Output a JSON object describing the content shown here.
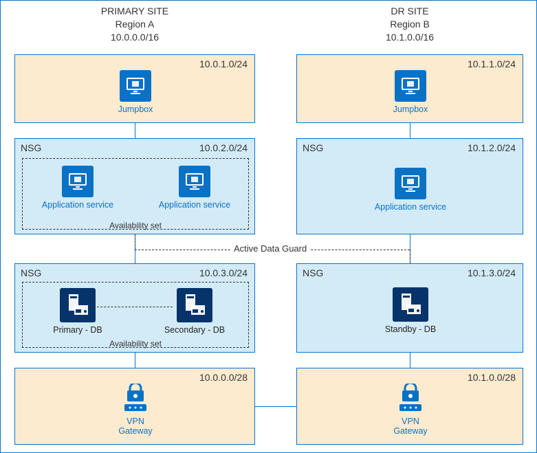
{
  "primary": {
    "title": "PRIMARY SITE",
    "region": "Region A",
    "cidr": "10.0.0.0/16",
    "tiers": {
      "jump": {
        "cidr": "10.0.1.0/24",
        "node": "Jumpbox"
      },
      "app": {
        "nsg": "NSG",
        "cidr": "10.0.2.0/24",
        "avset": "Availability set",
        "node1": "Application service",
        "node2": "Application service"
      },
      "db": {
        "nsg": "NSG",
        "cidr": "10.0.3.0/24",
        "avset": "Availability set",
        "node1": "Primary - DB",
        "node2": "Secondary - DB"
      },
      "gw": {
        "cidr": "10.0.0.0/28",
        "node": "VPN\nGateway"
      }
    }
  },
  "dr": {
    "title": "DR SITE",
    "region": "Region B",
    "cidr": "10.1.0.0/16",
    "tiers": {
      "jump": {
        "cidr": "10.1.1.0/24",
        "node": "Jumpbox"
      },
      "app": {
        "nsg": "NSG",
        "cidr": "10.1.2.0/24",
        "node": "Application service"
      },
      "db": {
        "nsg": "NSG",
        "cidr": "10.1.3.0/24",
        "node": "Standby - DB"
      },
      "gw": {
        "cidr": "10.1.0.0/28",
        "node": "VPN\nGateway"
      }
    }
  },
  "link_label": "Active Data Guard"
}
